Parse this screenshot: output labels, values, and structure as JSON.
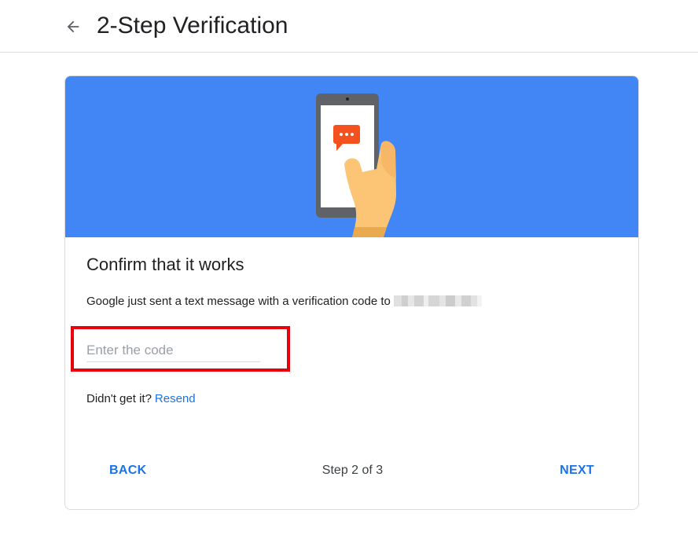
{
  "header": {
    "title": "2-Step Verification",
    "back_icon": "arrow-left-icon"
  },
  "banner": {
    "background": "#4285f4",
    "illustration": "phone-with-message-icon"
  },
  "card": {
    "heading": "Confirm that it works",
    "message": "Google just sent a text message with a verification code to",
    "code_input": {
      "placeholder": "Enter the code",
      "value": ""
    },
    "resend_prompt": "Didn't get it?",
    "resend_label": "Resend"
  },
  "footer": {
    "back_label": "BACK",
    "step_text": "Step 2 of 3",
    "next_label": "NEXT"
  },
  "colors": {
    "accent": "#1a73e8",
    "highlight": "#e8000b"
  }
}
